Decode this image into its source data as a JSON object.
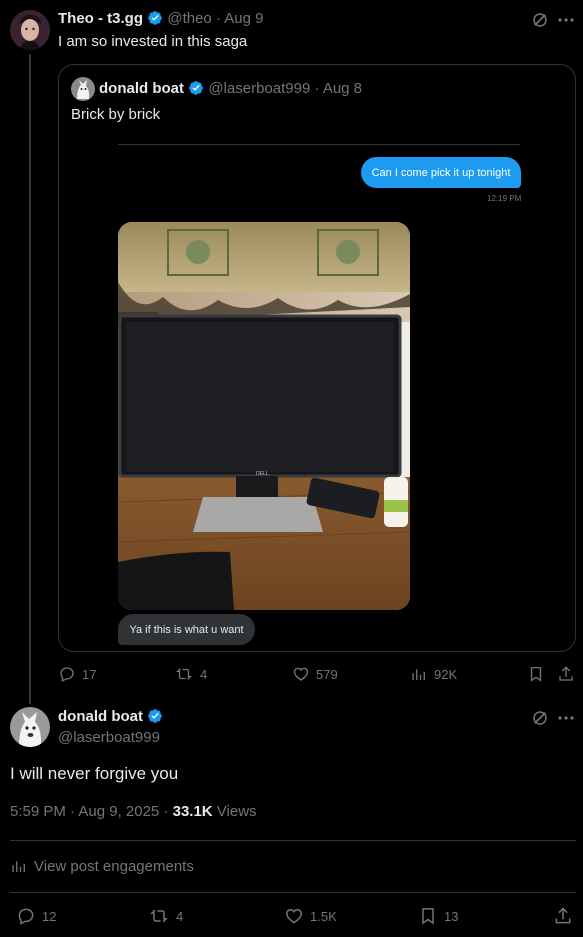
{
  "quote_tweet": {
    "author_name": "Theo - t3.gg",
    "handle": "@theo",
    "date": "· Aug 9",
    "text": "I am so invested in this saga"
  },
  "quoted": {
    "author_name": "donald boat",
    "handle": "@laserboat999",
    "date": "· Aug 8",
    "text": "Brick by brick",
    "dm_sent": "Can I come pick it up tonight",
    "dm_time": "12:19 PM",
    "dm_reply": "Ya if this is what u want",
    "monitor_brand": "DELL"
  },
  "quote_actions": {
    "replies": "17",
    "reposts": "4",
    "likes": "579",
    "views": "92K"
  },
  "main_tweet": {
    "author_name": "donald boat",
    "handle": "@laserboat999",
    "text": "I will never forgive you",
    "timestamp": "5:59 PM · Aug 9, 2025 · ",
    "views_count": "33.1K",
    "views_label": " Views",
    "engagements": "View post engagements"
  },
  "main_actions": {
    "replies": "12",
    "reposts": "4",
    "likes": "1.5K",
    "bookmarks": "13"
  },
  "colors": {
    "accent": "#1d9bf0",
    "muted": "#71767b",
    "border": "#2f3336"
  },
  "icons": [
    "grok-icon",
    "more-icon",
    "verified-icon",
    "reply-icon",
    "repost-icon",
    "like-icon",
    "views-icon",
    "bookmark-icon",
    "share-icon",
    "engagements-icon"
  ]
}
